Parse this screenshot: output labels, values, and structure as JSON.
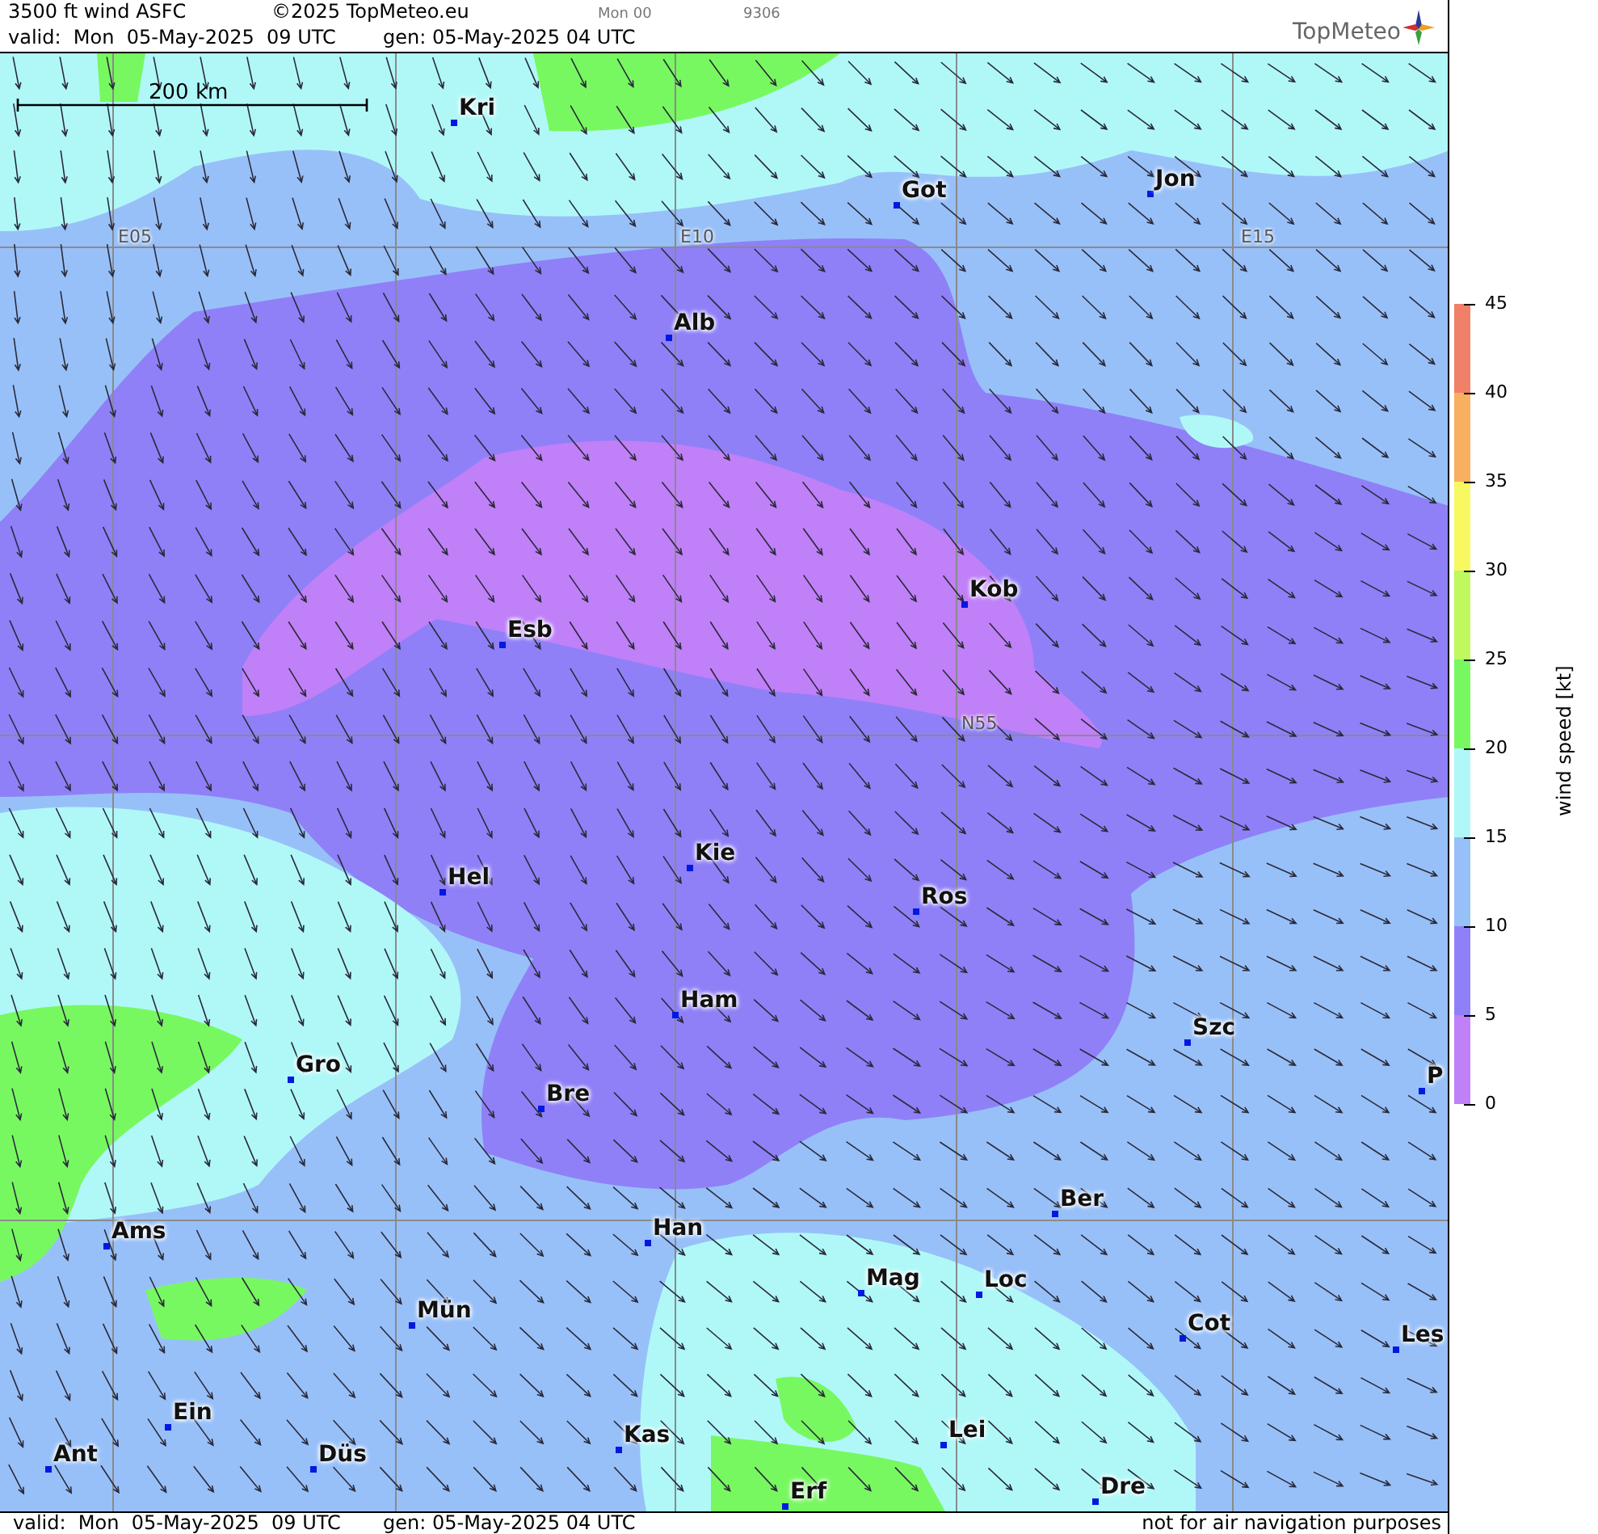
{
  "header": {
    "title": "3500 ft wind ASFC",
    "copyright": "©2025 TopMeteo.eu",
    "run": "Mon 00",
    "code": "9306",
    "valid": "valid:  Mon  05-May-2025  09 UTC",
    "gen": "gen: 05-May-2025 04 UTC",
    "logo": "TopMeteo"
  },
  "map": {
    "scale_bar": "200 km",
    "grid_labels": [
      "E05",
      "E10",
      "E15",
      "N55"
    ],
    "cities": [
      "Kri",
      "Got",
      "Jon",
      "Alb",
      "Kob",
      "Esb",
      "Kie",
      "Hel",
      "Ros",
      "Ham",
      "Szc",
      "Gro",
      "Bre",
      "P",
      "Ber",
      "Ams",
      "Han",
      "Mag",
      "Loc",
      "Cot",
      "Les",
      "Mün",
      "Ein",
      "Kas",
      "Lei",
      "Ant",
      "Düs",
      "Dre",
      "Erf"
    ]
  },
  "legend": {
    "title": "wind speed [kt]",
    "ticks": [
      "45",
      "40",
      "35",
      "30",
      "25",
      "20",
      "15",
      "10",
      "5",
      "0"
    ],
    "bands": [
      {
        "color": "#f08068"
      },
      {
        "color": "#f8b060"
      },
      {
        "color": "#f8f860"
      },
      {
        "color": "#c0f860"
      },
      {
        "color": "#78f860"
      },
      {
        "color": "#b0f8f8"
      },
      {
        "color": "#98c0f8"
      },
      {
        "color": "#8f80f8"
      },
      {
        "color": "#c080f8"
      }
    ]
  },
  "footer": {
    "valid": "valid:  Mon  05-May-2025  09 UTC",
    "gen": "gen: 05-May-2025 04 UTC",
    "disclaimer": "not for air navigation purposes"
  }
}
